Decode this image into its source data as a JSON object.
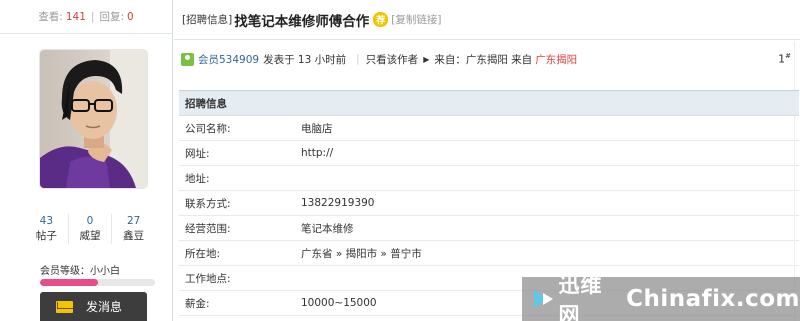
{
  "sidebar": {
    "views_label": "查看:",
    "views_value": "141",
    "replies_label": "回复:",
    "replies_value": "0",
    "counts": [
      {
        "value": "43",
        "label": "帖子"
      },
      {
        "value": "0",
        "label": "威望"
      },
      {
        "value": "27",
        "label": "鑫豆"
      }
    ],
    "level_text": "会员等级：小小白",
    "level_progress": 0.5,
    "message_button": "发消息"
  },
  "post": {
    "category": "[招聘信息]",
    "title": "找笔记本维修师傅合作",
    "badge": "荐",
    "copy_link": "[复制链接]",
    "author": "会员534909",
    "posted": "发表于 13 小时前",
    "only_author": "只看该作者",
    "from_label": "来自：",
    "from_value": "广东揭阳 来自",
    "from_highlight": "广东揭阳",
    "floor": "1",
    "floor_sup": "#"
  },
  "info": {
    "header": "招聘信息",
    "rows": [
      {
        "key": "公司名称:",
        "value": "电脑店"
      },
      {
        "key": "网址:",
        "value": "http://"
      },
      {
        "key": "地址:",
        "value": ""
      },
      {
        "key": "联系方式:",
        "value": "13822919390"
      },
      {
        "key": "经营范围:",
        "value": "笔记本维修"
      },
      {
        "key": "所在地:",
        "value": "广东省 » 揭阳市 » 普宁市"
      },
      {
        "key": "工作地点:",
        "value": ""
      },
      {
        "key": "薪金:",
        "value": "10000~15000"
      }
    ]
  },
  "watermark": {
    "cn": "迅维网",
    "en": "Chinafix.com"
  },
  "colors": {
    "accent_red": "#e03d3d",
    "link_blue": "#336699",
    "badge_yellow": "#f5c400",
    "level_pink": "#e84c8a"
  },
  "icons": [
    "user-icon",
    "envelope-icon",
    "arrow-right-icon",
    "chinafix-logo-icon",
    "avatar-photo"
  ]
}
